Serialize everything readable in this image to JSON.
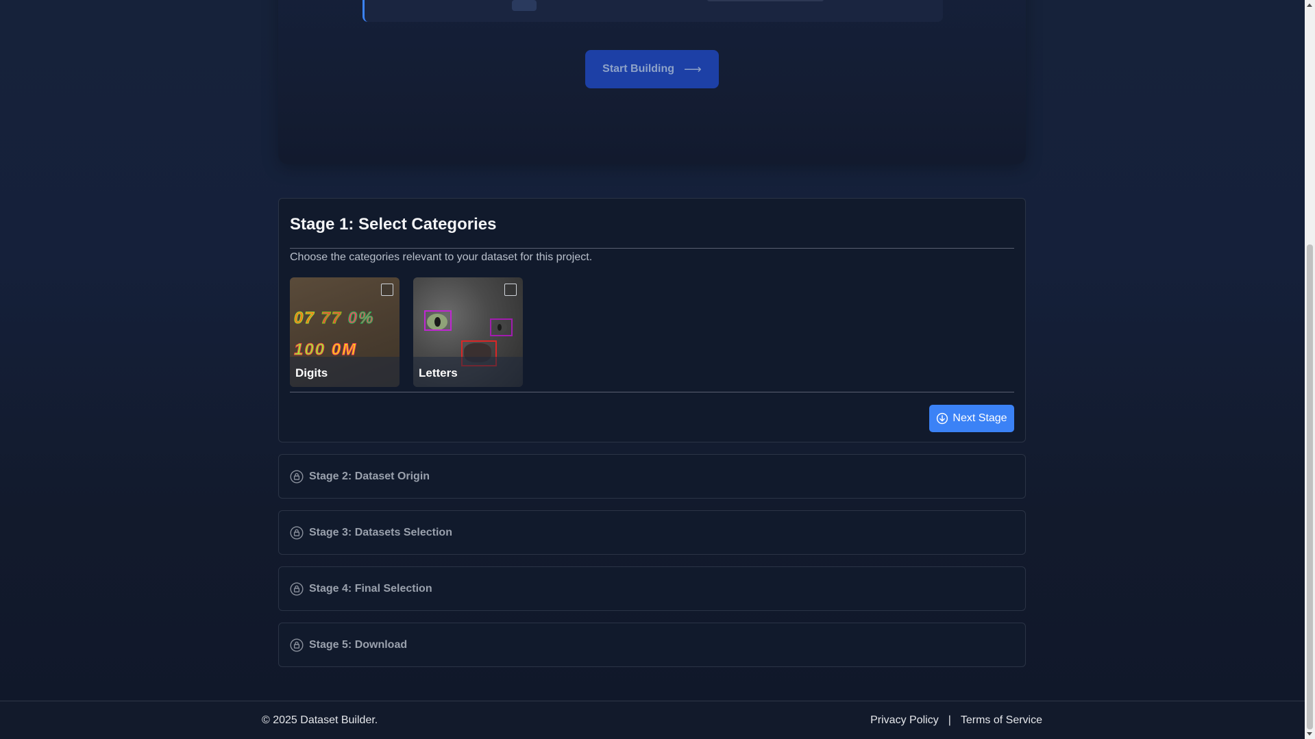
{
  "hero": {
    "start_button_label": "Start Building",
    "start_button_arrow": "⟶"
  },
  "stage1": {
    "title": "Stage 1: Select Categories",
    "description": "Choose the categories relevant to your dataset for this project.",
    "categories": [
      {
        "label": "Digits",
        "checked": false
      },
      {
        "label": "Letters",
        "checked": false
      }
    ],
    "next_button_label": "Next Stage"
  },
  "locked_stages": [
    {
      "title": "Stage 2: Dataset Origin",
      "icon": "lock-icon"
    },
    {
      "title": "Stage 3: Datasets Selection",
      "icon": "lock-icon"
    },
    {
      "title": "Stage 4: Final Selection",
      "icon": "lock-icon"
    },
    {
      "title": "Stage 5: Download",
      "icon": "lock-icon"
    }
  ],
  "footer": {
    "copyright": "© 2025 Dataset Builder.",
    "privacy": "Privacy Policy",
    "separator": "|",
    "terms": "Terms of Service"
  },
  "colors": {
    "accent": "#3b82f6",
    "start_button": "#1d40a6",
    "background": "#141c2e"
  }
}
